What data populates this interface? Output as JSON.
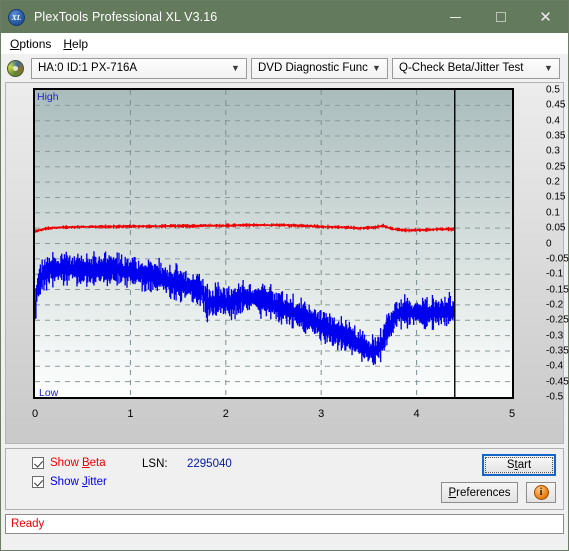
{
  "window": {
    "title": "PlexTools Professional XL V3.16",
    "app_icon": "xl-logo-icon",
    "minimize": "minimize-icon",
    "maximize": "maximize-icon",
    "close": "close-icon"
  },
  "menu": {
    "items": [
      {
        "label": "Options",
        "accel": "O"
      },
      {
        "label": "Help",
        "accel": "H"
      }
    ]
  },
  "toolbar": {
    "drive_icon": "disc-icon",
    "drive": {
      "value": "HA:0 ID:1  PX-716A",
      "chevron": "chevron-down-icon"
    },
    "function": {
      "value": "DVD Diagnostic Functions",
      "chevron": "chevron-down-icon"
    },
    "test": {
      "value": "Q-Check Beta/Jitter Test",
      "chevron": "chevron-down-icon"
    }
  },
  "chart_labels": {
    "high": "High",
    "low": "Low"
  },
  "chart_data": {
    "type": "line",
    "title": "Q-Check Beta/Jitter Test",
    "xlabel": "",
    "ylabel": "",
    "xlim": [
      0,
      5
    ],
    "ylim": [
      -0.5,
      0.5
    ],
    "grid": true,
    "x_ticks": [
      "0",
      "1",
      "2",
      "3",
      "4",
      "5"
    ],
    "y_ticks": [
      "0.5",
      "0.45",
      "0.4",
      "0.35",
      "0.3",
      "0.25",
      "0.2",
      "0.15",
      "0.1",
      "0.05",
      "0",
      "-0.05",
      "-0.1",
      "-0.15",
      "-0.2",
      "-0.25",
      "-0.3",
      "-0.35",
      "-0.4",
      "-0.45",
      "-0.5"
    ],
    "data_end_marker_x": 4.4,
    "legend_position": "bottom-left",
    "series": [
      {
        "name": "Show Beta",
        "color": "#ee0000",
        "x": [
          0.0,
          0.05,
          0.1,
          0.2,
          0.3,
          0.45,
          0.6,
          0.8,
          1.0,
          1.2,
          1.4,
          1.6,
          1.8,
          2.0,
          2.2,
          2.4,
          2.6,
          2.8,
          3.0,
          3.2,
          3.4,
          3.55,
          3.65,
          3.75,
          3.9,
          4.05,
          4.2,
          4.4
        ],
        "values": [
          0.04,
          0.043,
          0.048,
          0.051,
          0.053,
          0.054,
          0.055,
          0.055,
          0.056,
          0.056,
          0.057,
          0.057,
          0.058,
          0.058,
          0.06,
          0.06,
          0.06,
          0.058,
          0.055,
          0.053,
          0.05,
          0.052,
          0.058,
          0.047,
          0.043,
          0.044,
          0.046,
          0.047
        ],
        "noise": 0.006
      },
      {
        "name": "Show Jitter",
        "color": "#0000ee",
        "x": [
          0.0,
          0.03,
          0.08,
          0.15,
          0.25,
          0.4,
          0.55,
          0.7,
          0.85,
          1.0,
          1.15,
          1.3,
          1.45,
          1.6,
          1.75,
          1.82,
          1.9,
          2.05,
          2.2,
          2.4,
          2.55,
          2.7,
          2.85,
          3.0,
          3.15,
          3.3,
          3.45,
          3.55,
          3.63,
          3.7,
          3.78,
          3.9,
          4.05,
          4.2,
          4.35,
          4.4
        ],
        "values": [
          -0.215,
          -0.135,
          -0.105,
          -0.085,
          -0.082,
          -0.08,
          -0.09,
          -0.082,
          -0.085,
          -0.09,
          -0.1,
          -0.11,
          -0.125,
          -0.14,
          -0.155,
          -0.2,
          -0.185,
          -0.19,
          -0.175,
          -0.185,
          -0.205,
          -0.225,
          -0.245,
          -0.265,
          -0.29,
          -0.31,
          -0.335,
          -0.36,
          -0.33,
          -0.28,
          -0.23,
          -0.225,
          -0.228,
          -0.225,
          -0.22,
          -0.222
        ],
        "noise": 0.05
      }
    ]
  },
  "controls": {
    "show_beta": {
      "label_pre": "Show ",
      "label_accel": "B",
      "label_post": "eta",
      "checked": true
    },
    "show_jitter": {
      "label_pre": "Show ",
      "label_accel": "J",
      "label_post": "itter",
      "checked": true
    },
    "lsn_label": "LSN:",
    "lsn_value": "2295040",
    "start_pre": "S",
    "start_accel": "t",
    "start_post": "art",
    "pref_pre": "",
    "pref_accel": "P",
    "pref_post": "references",
    "info_icon": "info-icon",
    "info_glyph": "i"
  },
  "status": {
    "text": "Ready"
  },
  "colors": {
    "titlebar": "#647a5c",
    "beta": "#ee0000",
    "jitter": "#0000ee",
    "status_text": "#ee0000",
    "accent_focus": "#1467c8"
  }
}
